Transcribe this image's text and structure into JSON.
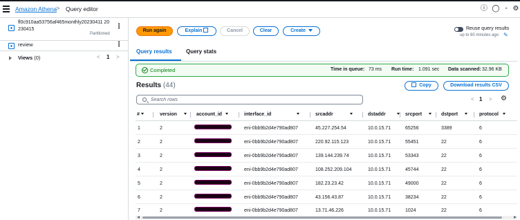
{
  "breadcrumb": {
    "service": "Amazon Athena",
    "separator": ">",
    "current": "Query editor"
  },
  "top_icons": [
    "info-icon",
    "help-icon",
    "notifications-icon",
    "settings-icon"
  ],
  "sidebar": {
    "database_name": "fl0c910aa53756af465monthly20230411 20230415",
    "database_tag": "Partitioned",
    "review_label": "review",
    "views_label": "Views",
    "views_count": "(0)",
    "pager_prev": "<",
    "pager_page": "1",
    "pager_next": ">"
  },
  "toolbar": {
    "run_again": "Run again",
    "explain": "Explain",
    "cancel": "Cancel",
    "clear": "Clear",
    "create": "Create",
    "reuse_label": "Reuse query results",
    "reuse_sub": "up to 60 minutes ago"
  },
  "tabs": {
    "results": "Query results",
    "stats": "Query stats"
  },
  "status": {
    "state": "Completed",
    "queue_label": "Time in queue:",
    "queue_value": "73 ms",
    "run_label": "Run time:",
    "run_value": "1.091 sec",
    "scanned_label": "Data scanned:",
    "scanned_value": "32.96 KB"
  },
  "results": {
    "title": "Results",
    "count": "(44)",
    "copy": "Copy",
    "download": "Download results CSV",
    "search_placeholder": "Search rows",
    "page": "1",
    "prev": "<",
    "next": ">"
  },
  "table": {
    "columns": [
      "#",
      "version",
      "account_id",
      "interface_id",
      "srcaddr",
      "dstaddr",
      "srcport",
      "dstport",
      "protocol"
    ],
    "rows": [
      [
        "1",
        "2",
        "",
        "eni-0bb9b2d4e790ad807",
        "45.227.254.54",
        "10.0.15.71",
        "65256",
        "3389",
        "6"
      ],
      [
        "2",
        "2",
        "",
        "eni-0bb9b2d4e790ad807",
        "220.92.115.123",
        "10.0.15.71",
        "55451",
        "22",
        "6"
      ],
      [
        "3",
        "2",
        "",
        "eni-0bb9b2d4e790ad807",
        "139.144.239.74",
        "10.0.15.71",
        "53343",
        "22",
        "6"
      ],
      [
        "4",
        "2",
        "",
        "eni-0bb9b2d4e790ad807",
        "108.252.209.104",
        "10.0.15.71",
        "45744",
        "22",
        "6"
      ],
      [
        "5",
        "2",
        "",
        "eni-0bb9b2d4e790ad807",
        "182.23.23.42",
        "10.0.15.71",
        "49000",
        "22",
        "6"
      ],
      [
        "6",
        "2",
        "",
        "eni-0bb9b2d4e790ad807",
        "43.156.43.87",
        "10.0.15.71",
        "38234",
        "22",
        "6"
      ],
      [
        "7",
        "2",
        "",
        "eni-0bb9b2d4e790ad807",
        "13.71.46.226",
        "10.0.15.71",
        "1024",
        "22",
        "6"
      ]
    ]
  },
  "colors": {
    "accent": "#0972d3",
    "primary_button": "#ff9900",
    "success": "#037f0c"
  }
}
